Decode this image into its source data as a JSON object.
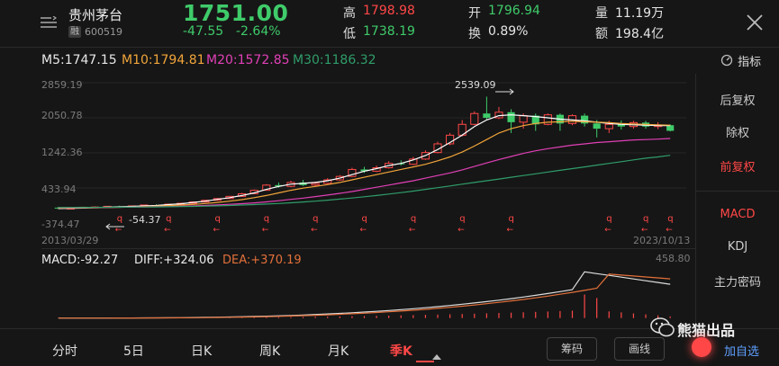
{
  "header": {
    "stock_name": "贵州茅台",
    "badge": "融",
    "stock_code": "600519",
    "price": "1751.00",
    "change": "-47.55",
    "change_pct": "-2.64%",
    "high_label": "高",
    "high_value": "1798.98",
    "low_label": "低",
    "low_value": "1738.19",
    "open_label": "开",
    "open_value": "1796.94",
    "turnover_label": "换",
    "turnover_value": "0.89%",
    "volume_label": "量",
    "volume_value": "11.19万",
    "amount_label": "额",
    "amount_value": "198.4亿"
  },
  "ma_bar": {
    "ma5": "M5:1747.15",
    "ma10": "M10:1794.81",
    "ma20": "M20:1572.85",
    "ma30": "M30:1186.32",
    "indicator_label": "指标"
  },
  "colors": {
    "up": "#ff4747",
    "down": "#3fcb6a",
    "ma5": "#ffffff",
    "ma10": "#f2a53a",
    "ma20": "#e040b6",
    "ma30": "#2f9d6a",
    "macd_diff": "#dcdcdc",
    "macd_dea": "#e2703a"
  },
  "price_axis": [
    "2859.19",
    "2050.78",
    "1242.36",
    "433.94",
    "-374.47"
  ],
  "dates": {
    "start": "2013/03/29",
    "end": "2023/10/13"
  },
  "annotations": {
    "max": "2539.09",
    "min": "-54.37",
    "marker": "q"
  },
  "macd_bar": {
    "macd": "MACD:-92.27",
    "diff": "DIFF:+324.06",
    "dea": "DEA:+370.19",
    "max": "458.80"
  },
  "side_menu": [
    "后复权",
    "除权",
    "前复权",
    "MACD",
    "KDJ",
    "主力密码"
  ],
  "side_active": "前复权",
  "tabs": [
    "分时",
    "5日",
    "日K",
    "周K",
    "月K",
    "季K"
  ],
  "active_tab": "季K",
  "buttons": {
    "chips": "筹码",
    "draw": "画线",
    "watch": "加自选"
  },
  "watermark": "熊猫出品",
  "chart_data": {
    "type": "candlestick",
    "period": "quarterly",
    "ylim": [
      -374.47,
      2859.19
    ],
    "candles": [
      {
        "o": -20,
        "c": -40,
        "h": 0,
        "l": -54
      },
      {
        "o": -40,
        "c": -30,
        "h": -10,
        "l": -54
      },
      {
        "o": -30,
        "c": -10,
        "h": 0,
        "l": -40
      },
      {
        "o": -10,
        "c": -5,
        "h": 10,
        "l": -20
      },
      {
        "o": -5,
        "c": 10,
        "h": 20,
        "l": -15
      },
      {
        "o": 10,
        "c": 0,
        "h": 25,
        "l": -10
      },
      {
        "o": 0,
        "c": 20,
        "h": 30,
        "l": -5
      },
      {
        "o": 20,
        "c": 40,
        "h": 50,
        "l": 10
      },
      {
        "o": 40,
        "c": 30,
        "h": 55,
        "l": 20
      },
      {
        "o": 30,
        "c": 60,
        "h": 70,
        "l": 25
      },
      {
        "o": 60,
        "c": 80,
        "h": 90,
        "l": 50
      },
      {
        "o": 80,
        "c": 110,
        "h": 120,
        "l": 70
      },
      {
        "o": 110,
        "c": 150,
        "h": 160,
        "l": 100
      },
      {
        "o": 150,
        "c": 190,
        "h": 200,
        "l": 140
      },
      {
        "o": 190,
        "c": 240,
        "h": 250,
        "l": 180
      },
      {
        "o": 240,
        "c": 300,
        "h": 320,
        "l": 230
      },
      {
        "o": 300,
        "c": 380,
        "h": 400,
        "l": 290
      },
      {
        "o": 380,
        "c": 500,
        "h": 520,
        "l": 370
      },
      {
        "o": 500,
        "c": 470,
        "h": 560,
        "l": 440
      },
      {
        "o": 470,
        "c": 560,
        "h": 600,
        "l": 450
      },
      {
        "o": 560,
        "c": 500,
        "h": 620,
        "l": 480
      },
      {
        "o": 500,
        "c": 540,
        "h": 580,
        "l": 470
      },
      {
        "o": 540,
        "c": 620,
        "h": 660,
        "l": 520
      },
      {
        "o": 620,
        "c": 700,
        "h": 730,
        "l": 600
      },
      {
        "o": 700,
        "c": 860,
        "h": 900,
        "l": 680
      },
      {
        "o": 860,
        "c": 820,
        "h": 920,
        "l": 780
      },
      {
        "o": 820,
        "c": 900,
        "h": 950,
        "l": 800
      },
      {
        "o": 900,
        "c": 1000,
        "h": 1050,
        "l": 880
      },
      {
        "o": 1000,
        "c": 980,
        "h": 1070,
        "l": 950
      },
      {
        "o": 980,
        "c": 1100,
        "h": 1150,
        "l": 960
      },
      {
        "o": 1100,
        "c": 1250,
        "h": 1300,
        "l": 1080
      },
      {
        "o": 1250,
        "c": 1450,
        "h": 1500,
        "l": 1230
      },
      {
        "o": 1450,
        "c": 1650,
        "h": 1700,
        "l": 1420
      },
      {
        "o": 1650,
        "c": 1900,
        "h": 2000,
        "l": 1620
      },
      {
        "o": 1900,
        "c": 2150,
        "h": 2200,
        "l": 1880
      },
      {
        "o": 2150,
        "c": 2050,
        "h": 2539,
        "l": 2000
      },
      {
        "o": 2050,
        "c": 2180,
        "h": 2300,
        "l": 2020
      },
      {
        "o": 2180,
        "c": 1950,
        "h": 2250,
        "l": 1700
      },
      {
        "o": 1950,
        "c": 2100,
        "h": 2150,
        "l": 1800
      },
      {
        "o": 2100,
        "c": 1900,
        "h": 2150,
        "l": 1750
      },
      {
        "o": 1900,
        "c": 2120,
        "h": 2150,
        "l": 1880
      },
      {
        "o": 2120,
        "c": 1920,
        "h": 2150,
        "l": 1750
      },
      {
        "o": 1920,
        "c": 2100,
        "h": 2130,
        "l": 1880
      },
      {
        "o": 2100,
        "c": 1920,
        "h": 2150,
        "l": 1850
      },
      {
        "o": 1920,
        "c": 1800,
        "h": 2000,
        "l": 1600
      },
      {
        "o": 1800,
        "c": 1900,
        "h": 1980,
        "l": 1700
      },
      {
        "o": 1900,
        "c": 1850,
        "h": 1990,
        "l": 1780
      },
      {
        "o": 1850,
        "c": 1940,
        "h": 1980,
        "l": 1800
      },
      {
        "o": 1940,
        "c": 1850,
        "h": 1980,
        "l": 1800
      },
      {
        "o": 1850,
        "c": 1880,
        "h": 1950,
        "l": 1790
      },
      {
        "o": 1880,
        "c": 1751,
        "h": 1900,
        "l": 1738
      }
    ],
    "ma": {
      "ma5": [
        -40,
        -35,
        -30,
        -20,
        -10,
        0,
        10,
        20,
        30,
        50,
        70,
        100,
        130,
        170,
        210,
        260,
        320,
        400,
        470,
        520,
        540,
        560,
        600,
        660,
        740,
        820,
        880,
        950,
        1000,
        1080,
        1180,
        1320,
        1480,
        1650,
        1850,
        2000,
        2100,
        2120,
        2100,
        2080,
        2050,
        2020,
        2000,
        1980,
        1950,
        1920,
        1900,
        1890,
        1880,
        1870,
        1870
      ],
      "ma10": [
        -30,
        -28,
        -25,
        -22,
        -18,
        -12,
        -5,
        5,
        15,
        25,
        40,
        55,
        75,
        100,
        130,
        165,
        210,
        260,
        320,
        380,
        430,
        470,
        510,
        560,
        620,
        680,
        740,
        800,
        860,
        920,
        980,
        1060,
        1150,
        1260,
        1400,
        1550,
        1700,
        1800,
        1870,
        1920,
        1950,
        1960,
        1970,
        1960,
        1950,
        1940,
        1920,
        1910,
        1900,
        1890,
        1880
      ],
      "ma20": [
        -20,
        -19,
        -18,
        -17,
        -15,
        -12,
        -8,
        -4,
        0,
        5,
        12,
        20,
        30,
        42,
        56,
        72,
        90,
        112,
        140,
        170,
        200,
        235,
        270,
        310,
        350,
        400,
        450,
        500,
        550,
        600,
        660,
        720,
        780,
        850,
        930,
        1010,
        1090,
        1160,
        1230,
        1290,
        1340,
        1380,
        1420,
        1450,
        1480,
        1500,
        1520,
        1540,
        1550,
        1560,
        1573
      ],
      "ma30": [
        -15,
        -15,
        -14,
        -13,
        -12,
        -10,
        -8,
        -6,
        -3,
        0,
        4,
        9,
        15,
        22,
        30,
        40,
        50,
        62,
        76,
        92,
        110,
        130,
        152,
        176,
        202,
        230,
        260,
        292,
        326,
        362,
        400,
        440,
        480,
        520,
        560,
        600,
        640,
        680,
        720,
        760,
        800,
        840,
        880,
        920,
        960,
        1000,
        1040,
        1080,
        1120,
        1150,
        1186
      ]
    }
  }
}
